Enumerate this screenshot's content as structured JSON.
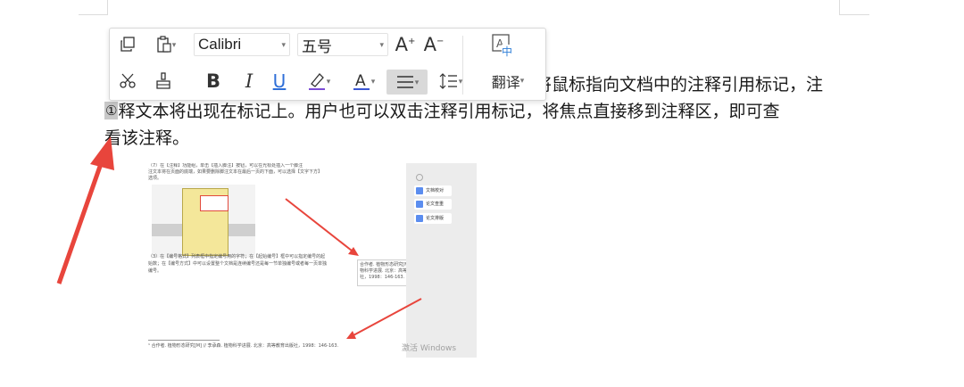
{
  "toolbar": {
    "font_name": "Calibri",
    "font_size": "五号",
    "translate_label": "翻译",
    "icons": [
      "copy-icon",
      "paste-icon",
      "font-grow-icon",
      "font-shrink-icon",
      "text-convert-icon",
      "cut-icon",
      "format-painter-icon",
      "bold-icon",
      "italic-icon",
      "underline-icon",
      "highlight-icon",
      "font-color-icon",
      "align-icon",
      "line-spacing-icon"
    ]
  },
  "document": {
    "line1": "将鼠标指向文档中的注释引用标记，注",
    "footnote_mark": "①",
    "line2": "释文本将出现在标记上。用户也可以双击注释引用标记，将焦点直接移到注释区，即可查",
    "line3": "看该注释。"
  },
  "screenshot": {
    "text_top_1": "（7）在【注释】功能组，单击【插入脚注】按钮，可以在光标处插入一个脚注",
    "text_top_2": "注文本将在页面的底端，如果要删除脚注文本在最后一页的下面，可以选择【文字下方】",
    "text_top_3": "选项。",
    "text_para_1": "（3）在【编号格式】列表框中指定编号用的字符；在【起始编号】框中可以指定编号的起",
    "text_para_2": "始数；在【编号方式】中可以设置整个文档是连续编号还是每一节单独编号或者每一页单独",
    "text_para_3": "编号。",
    "tooltip_1": "合作者. 植物形态研究[M]//李承森. 植",
    "tooltip_2": "物科学进展. 北京：高等教育出版",
    "tooltip_3": "社，1998：146-163.",
    "footnote": "¹ 合作者. 植物形态研究[M] // 李承森. 植物科学进展. 北京：高等教育出版社，1998：146-163.",
    "side_items": [
      "文档校对",
      "论文查重",
      "论文排版"
    ],
    "watermark": "激活 Windows"
  },
  "colors": {
    "arrow": "#e8453c",
    "accent": "#5b8def",
    "highlight_under": "#7b4bd6",
    "font_color_under": "#3a56d4"
  }
}
